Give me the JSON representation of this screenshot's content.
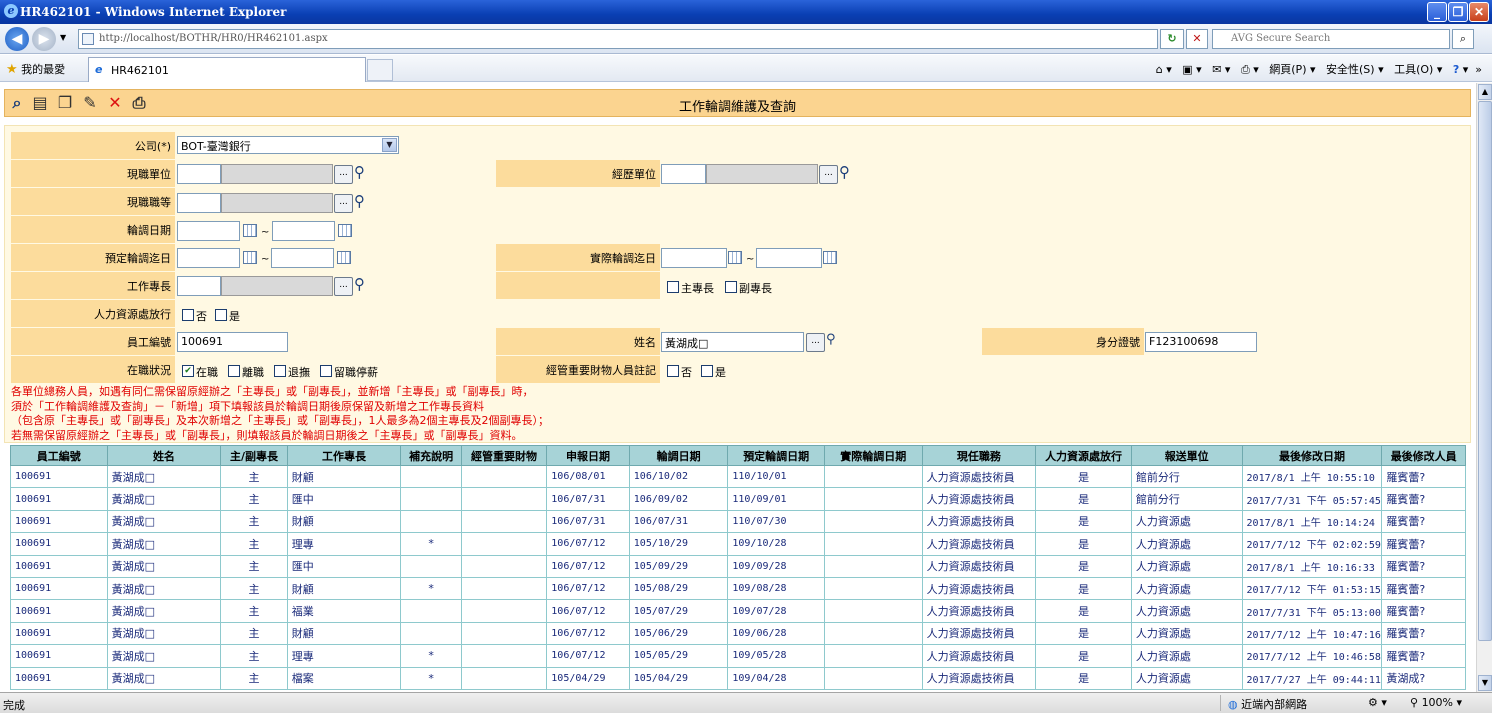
{
  "window": {
    "title": "HR462101 - Windows Internet Explorer"
  },
  "browser": {
    "url": "http://localhost/BOTHR/HR0/HR462101.aspx",
    "search_placeholder": "AVG Secure Search",
    "favorites_label": "我的最愛",
    "tab_label": "HR462101",
    "cmd": {
      "page": "網頁(P)",
      "safety": "安全性(S)",
      "tools": "工具(O)"
    }
  },
  "toolbar": {
    "icons": [
      "search-icon",
      "add-icon",
      "copy-icon",
      "edit-icon",
      "delete-icon",
      "print-icon"
    ],
    "title": "工作輪調維護及查詢"
  },
  "form": {
    "company_label": "公司(*)",
    "company_value": "BOT-臺灣銀行",
    "current_unit_label": "現職單位",
    "past_unit_label": "經歷單位",
    "current_grade_label": "現職職等",
    "rotation_date_label": "輪調日期",
    "planned_date_label": "預定輪調迄日",
    "actual_date_label": "實際輪調迄日",
    "specialty_label": "工作專長",
    "main_specialty": "主專長",
    "sub_specialty": "副專長",
    "hr_release_label": "人力資源處放行",
    "no": "否",
    "yes": "是",
    "emp_no_label": "員工編號",
    "emp_no_value": "100691",
    "name_label": "姓名",
    "name_value": "黃湖成□",
    "id_label": "身分證號",
    "id_value": "F123100698",
    "status_label": "在職狀況",
    "status_options": [
      "在職",
      "離職",
      "退撫",
      "留職停薪"
    ],
    "status_checked": [
      true,
      false,
      false,
      false
    ],
    "property_label": "經管重要財物人員註記",
    "tilde": "~"
  },
  "notes": [
    "各單位總務人員，如遇有同仁需保留原經辦之「主專長」或「副專長」，並新增「主專長」或「副專長」時，",
    "須於「工作輪調維護及查詢」－「新增」項下填報該員於輪調日期後原保留及新增之工作專長資料",
    "（包含原「主專長」或「副專長」及本次新增之「主專長」或「副專長」，1人最多為2個主專長及2個副專長）；",
    "若無需保留原經辦之「主專長」或「副專長」，則填報該員於輪調日期後之「主專長」或「副專長」資料。"
  ],
  "grid": {
    "headers": [
      "員工編號",
      "姓名",
      "主/副專長",
      "工作專長",
      "補充說明",
      "經管重要財物",
      "申報日期",
      "輪調日期",
      "預定輪調日期",
      "實際輪調日期",
      "現任職務",
      "人力資源處放行",
      "報送單位",
      "最後修改日期",
      "最後修改人員"
    ],
    "rows": [
      [
        "100691",
        "黃湖成□",
        "主",
        "財顧",
        "",
        "",
        "106/08/01",
        "106/10/02",
        "110/10/01",
        "",
        "人力資源處技術員",
        "是",
        "館前分行",
        "2017/8/1 上午 10:55:10",
        "羅賓蕾?"
      ],
      [
        "100691",
        "黃湖成□",
        "主",
        "匯中",
        "",
        "",
        "106/07/31",
        "106/09/02",
        "110/09/01",
        "",
        "人力資源處技術員",
        "是",
        "館前分行",
        "2017/7/31 下午 05:57:45",
        "羅賓蕾?"
      ],
      [
        "100691",
        "黃湖成□",
        "主",
        "財顧",
        "",
        "",
        "106/07/31",
        "106/07/31",
        "110/07/30",
        "",
        "人力資源處技術員",
        "是",
        "人力資源處",
        "2017/8/1 上午 10:14:24",
        "羅賓蕾?"
      ],
      [
        "100691",
        "黃湖成□",
        "主",
        "理專",
        "*",
        "",
        "106/07/12",
        "105/10/29",
        "109/10/28",
        "",
        "人力資源處技術員",
        "是",
        "人力資源處",
        "2017/7/12 下午 02:02:59",
        "羅賓蕾?"
      ],
      [
        "100691",
        "黃湖成□",
        "主",
        "匯中",
        "",
        "",
        "106/07/12",
        "105/09/29",
        "109/09/28",
        "",
        "人力資源處技術員",
        "是",
        "人力資源處",
        "2017/8/1 上午 10:16:33",
        "羅賓蕾?"
      ],
      [
        "100691",
        "黃湖成□",
        "主",
        "財顧",
        "*",
        "",
        "106/07/12",
        "105/08/29",
        "109/08/28",
        "",
        "人力資源處技術員",
        "是",
        "人力資源處",
        "2017/7/12 下午 01:53:15",
        "羅賓蕾?"
      ],
      [
        "100691",
        "黃湖成□",
        "主",
        "福業",
        "",
        "",
        "106/07/12",
        "105/07/29",
        "109/07/28",
        "",
        "人力資源處技術員",
        "是",
        "人力資源處",
        "2017/7/31 下午 05:13:00",
        "羅賓蕾?"
      ],
      [
        "100691",
        "黃湖成□",
        "主",
        "財顧",
        "",
        "",
        "106/07/12",
        "105/06/29",
        "109/06/28",
        "",
        "人力資源處技術員",
        "是",
        "人力資源處",
        "2017/7/12 上午 10:47:16",
        "羅賓蕾?"
      ],
      [
        "100691",
        "黃湖成□",
        "主",
        "理專",
        "*",
        "",
        "106/07/12",
        "105/05/29",
        "109/05/28",
        "",
        "人力資源處技術員",
        "是",
        "人力資源處",
        "2017/7/12 上午 10:46:58",
        "羅賓蕾?"
      ],
      [
        "100691",
        "黃湖成□",
        "主",
        "檔案",
        "*",
        "",
        "105/04/29",
        "105/04/29",
        "109/04/28",
        "",
        "人力資源處技術員",
        "是",
        "人力資源處",
        "2017/7/27 上午 09:44:11",
        "黃湖成?"
      ]
    ]
  },
  "status": {
    "left": "完成",
    "zone": "近端內部網路",
    "zoom": "100%"
  }
}
